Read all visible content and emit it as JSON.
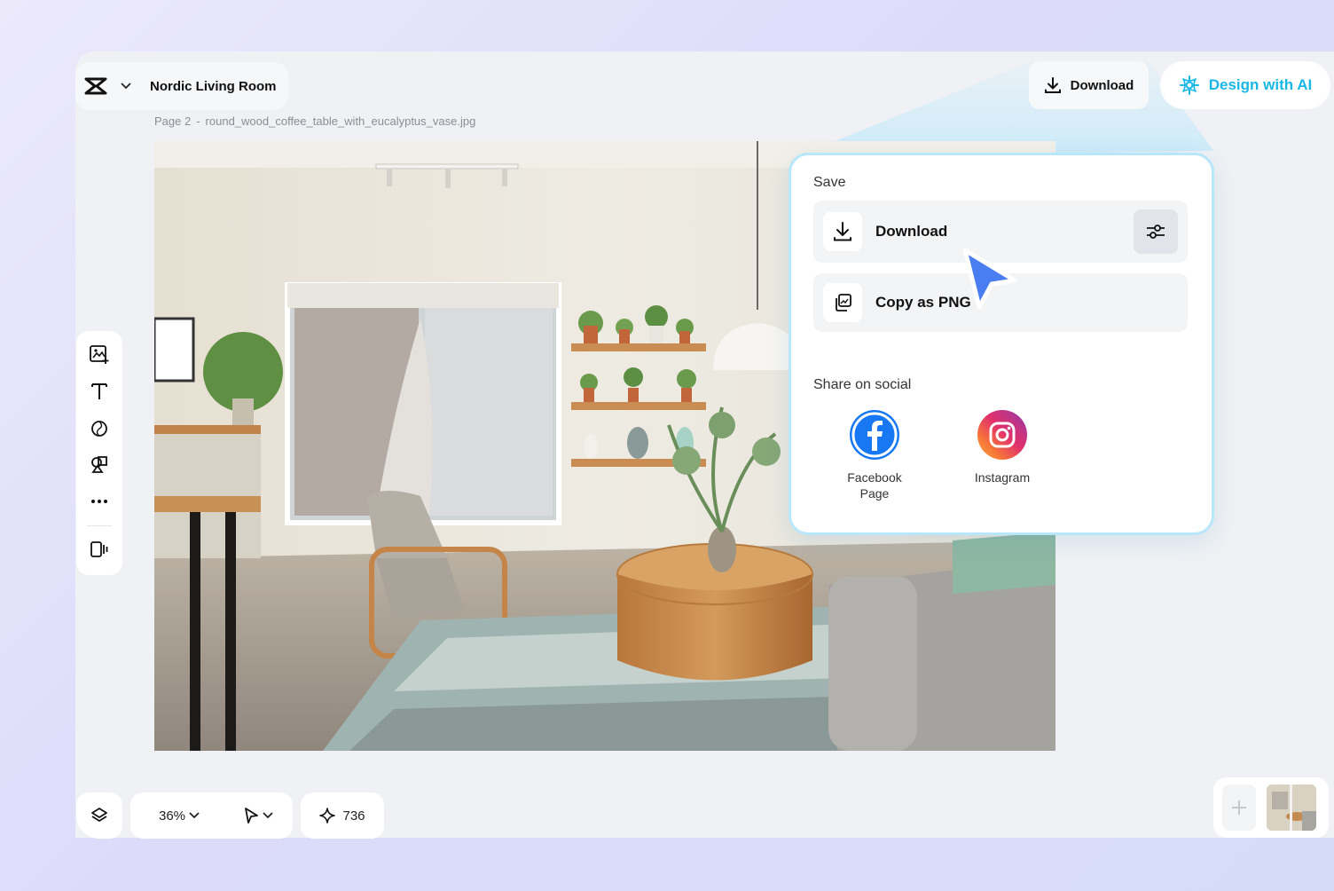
{
  "header": {
    "doc_title": "Nordic Living Room",
    "page_number": "Page 2",
    "page_separator": "-",
    "file_name": "round_wood_coffee_table_with_eucalyptus_vase.jpg",
    "download_label": "Download",
    "ai_label": "Design with AI"
  },
  "canvas": {
    "image_subject": "nordic-living-room-photo"
  },
  "side_toolbar": {
    "items": [
      "add-image-icon",
      "text-icon",
      "shapes-icon",
      "elements-icon",
      "more-icon",
      "mobile-preview-icon"
    ]
  },
  "bottom": {
    "zoom": "36%",
    "credits": "736"
  },
  "popover": {
    "save_heading": "Save",
    "download_label": "Download",
    "copy_label": "Copy as PNG",
    "social_heading": "Share on social",
    "social": [
      {
        "label": "Facebook\nPage",
        "icon": "facebook-icon",
        "color": "#1877f2"
      },
      {
        "label": "Instagram",
        "icon": "instagram-icon",
        "color": "#e1306c"
      }
    ]
  },
  "colors": {
    "accent": "#19b7e6",
    "popover_border": "#b8e6fb",
    "cursor": "#4a7df0"
  }
}
